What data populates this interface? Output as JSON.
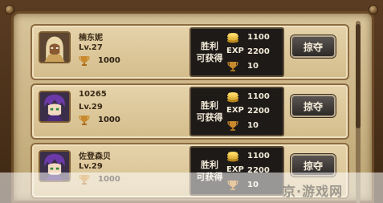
{
  "opponents": [
    {
      "name": "楠东妮",
      "level": "Lv.27",
      "trophies": "1000",
      "win_label": "胜利\n可获得",
      "coins": "1100",
      "exp_label": "EXP",
      "exp": "2200",
      "trophy_reward": "10",
      "button": "掠夺",
      "avatar": "desert-warrior-avatar"
    },
    {
      "name": "10265",
      "level": "Lv.29",
      "trophies": "1000",
      "win_label": "胜利\n可获得",
      "coins": "1100",
      "exp_label": "EXP",
      "exp": "2200",
      "trophy_reward": "10",
      "button": "掠夺",
      "avatar": "purple-hair-hero-avatar"
    },
    {
      "name": "佐登森贝",
      "level": "Lv.29",
      "trophies": "1000",
      "win_label": "胜利\n可获得",
      "coins": "1100",
      "exp_label": "EXP",
      "exp": "2200",
      "trophy_reward": "10",
      "button": "掠夺",
      "avatar": "purple-hair-hero-avatar"
    }
  ],
  "watermark": "京·游戏网",
  "colors": {
    "panel_dark": "#1d1a18",
    "parchment": "#d8c49a",
    "gold": "#e0b43c"
  }
}
